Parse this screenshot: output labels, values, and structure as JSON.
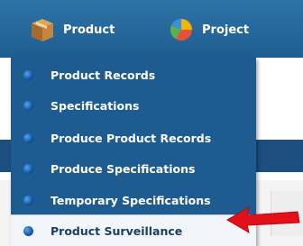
{
  "nav": {
    "items": [
      {
        "label": "Product",
        "icon": "box-icon"
      },
      {
        "label": "Project",
        "icon": "pie-chart-icon"
      }
    ]
  },
  "dropdown": {
    "items": [
      {
        "label": "Product Records"
      },
      {
        "label": "Specifications"
      },
      {
        "label": "Produce Product Records"
      },
      {
        "label": "Produce Specifications"
      },
      {
        "label": "Temporary Specifications"
      },
      {
        "label": "Product Surveillance",
        "selected": true
      }
    ]
  },
  "annotation": {
    "icon": "red-arrow-icon",
    "color": "#e3101a"
  },
  "colors": {
    "nav_bg": "#2e73a8",
    "menu_bg": "#1e5b90",
    "selected_bg": "#f2f6fb"
  }
}
